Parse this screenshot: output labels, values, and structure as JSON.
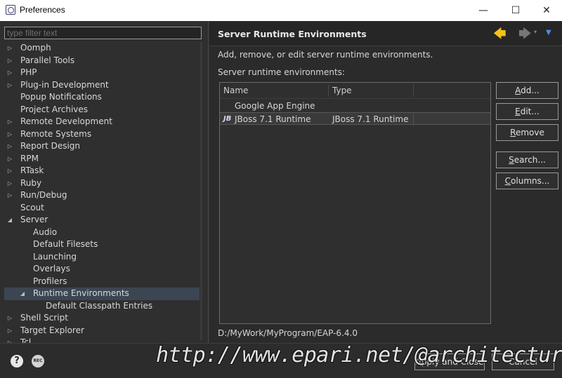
{
  "window": {
    "title": "Preferences",
    "minimize": "—",
    "maximize": "☐",
    "close": "✕"
  },
  "filter": {
    "placeholder": "type filter text"
  },
  "tree": [
    {
      "label": "Oomph",
      "arrow": "▷",
      "level": 0
    },
    {
      "label": "Parallel Tools",
      "arrow": "▷",
      "level": 0
    },
    {
      "label": "PHP",
      "arrow": "▷",
      "level": 0
    },
    {
      "label": "Plug-in Development",
      "arrow": "▷",
      "level": 0
    },
    {
      "label": "Popup Notifications",
      "arrow": "",
      "level": 0
    },
    {
      "label": "Project Archives",
      "arrow": "",
      "level": 0
    },
    {
      "label": "Remote Development",
      "arrow": "▷",
      "level": 0
    },
    {
      "label": "Remote Systems",
      "arrow": "▷",
      "level": 0
    },
    {
      "label": "Report Design",
      "arrow": "▷",
      "level": 0
    },
    {
      "label": "RPM",
      "arrow": "▷",
      "level": 0
    },
    {
      "label": "RTask",
      "arrow": "▷",
      "level": 0
    },
    {
      "label": "Ruby",
      "arrow": "▷",
      "level": 0
    },
    {
      "label": "Run/Debug",
      "arrow": "▷",
      "level": 0
    },
    {
      "label": "Scout",
      "arrow": "",
      "level": 0
    },
    {
      "label": "Server",
      "arrow": "◢",
      "level": 0
    },
    {
      "label": "Audio",
      "arrow": "",
      "level": 1
    },
    {
      "label": "Default Filesets",
      "arrow": "",
      "level": 1
    },
    {
      "label": "Launching",
      "arrow": "",
      "level": 1
    },
    {
      "label": "Overlays",
      "arrow": "",
      "level": 1
    },
    {
      "label": "Profilers",
      "arrow": "",
      "level": 1
    },
    {
      "label": "Runtime Environments",
      "arrow": "◢",
      "level": 1,
      "selected": true
    },
    {
      "label": "Default Classpath Entries",
      "arrow": "",
      "level": 2
    },
    {
      "label": "Shell Script",
      "arrow": "▷",
      "level": 0
    },
    {
      "label": "Target Explorer",
      "arrow": "▷",
      "level": 0
    },
    {
      "label": "Tcl",
      "arrow": "▷",
      "level": 0
    }
  ],
  "page": {
    "heading": "Server Runtime Environments",
    "description": "Add, remove, or edit server runtime environments.",
    "list_label": "Server runtime environments:",
    "nav": {
      "back": "🡄",
      "forward": "🡆",
      "forward_menu": "▾",
      "view_menu": "▼"
    }
  },
  "table": {
    "headers": {
      "name": "Name",
      "type": "Type"
    },
    "rows": [
      {
        "name": "Google App Engine",
        "type": "",
        "icon": "",
        "selected": false
      },
      {
        "name": "JBoss 7.1 Runtime",
        "type": "JBoss 7.1 Runtime",
        "icon": "jboss-icon",
        "selected": true
      }
    ]
  },
  "buttons": {
    "add": {
      "u": "A",
      "rest": "dd..."
    },
    "edit": {
      "u": "E",
      "rest": "dit..."
    },
    "remove": {
      "u": "R",
      "rest": "emove"
    },
    "search": {
      "u": "S",
      "rest": "earch..."
    },
    "columns": {
      "u": "C",
      "rest": "olumns..."
    }
  },
  "location_path": "D:/MyWork/MyProgram/EAP-6.4.0",
  "footer": {
    "help": "?",
    "rec": "REC",
    "apply_close": "Apply and Close",
    "cancel": "Cancel"
  },
  "watermark": "http://www.epari.net/@architecture"
}
